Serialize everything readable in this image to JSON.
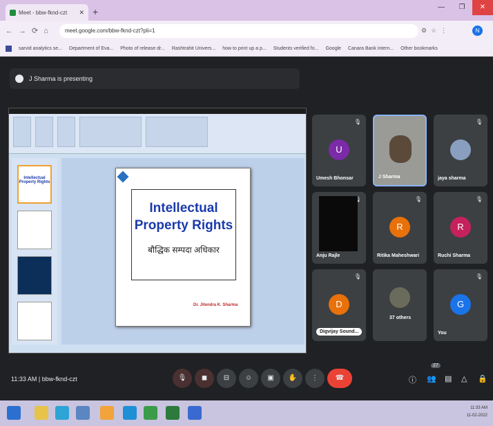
{
  "browser": {
    "tab_title": "Meet - bbw-fknd-czt",
    "url": "meet.google.com/bbw-fknd-czt?pli=1",
    "bookmarks": [
      "sarvid analytics se...",
      "Department of Eva...",
      "Photo of release dr...",
      "Rashtrahit Univers...",
      "how to print up a p...",
      "Students verified fo...",
      "Google",
      "Canara Bank intern...",
      "Other bookmarks"
    ],
    "profile_initial": "N"
  },
  "meet": {
    "presenting_text": "J Sharma is presenting",
    "meeting_time": "11:33 AM",
    "meeting_code": "bbw-fknd-czt",
    "participants_count": "27",
    "tiles": [
      {
        "name": "Umesh Bhonsar",
        "initial": "U",
        "color": "#7b2aa8"
      },
      {
        "name": "J Sharma",
        "initial": "",
        "color": "#9a9a96"
      },
      {
        "name": "jaya sharma",
        "initial": "",
        "color": "#3c4043"
      },
      {
        "name": "Anju Rajle",
        "initial": "",
        "color": "#0a0a0a"
      },
      {
        "name": "Ritika Maheshwari",
        "initial": "R",
        "color": "#e8710a"
      },
      {
        "name": "Ruchi Sharma",
        "initial": "R",
        "color": "#c5225b"
      },
      {
        "name": "Digvijay Sound...",
        "initial": "D",
        "color": "#e8710a"
      },
      {
        "name": "37 others",
        "initial": "",
        "color": "#3c4043"
      },
      {
        "name": "You",
        "initial": "G",
        "color": "#1a73e8"
      }
    ]
  },
  "slide": {
    "title": "Intellectual Property Rights",
    "hindi_title": "बौद्धिक सम्पदा अधिकार",
    "author": "Dr. Jitendra K. Sharma"
  },
  "taskbar": {
    "time": "11:33 AM",
    "date": "11-02-2022"
  }
}
